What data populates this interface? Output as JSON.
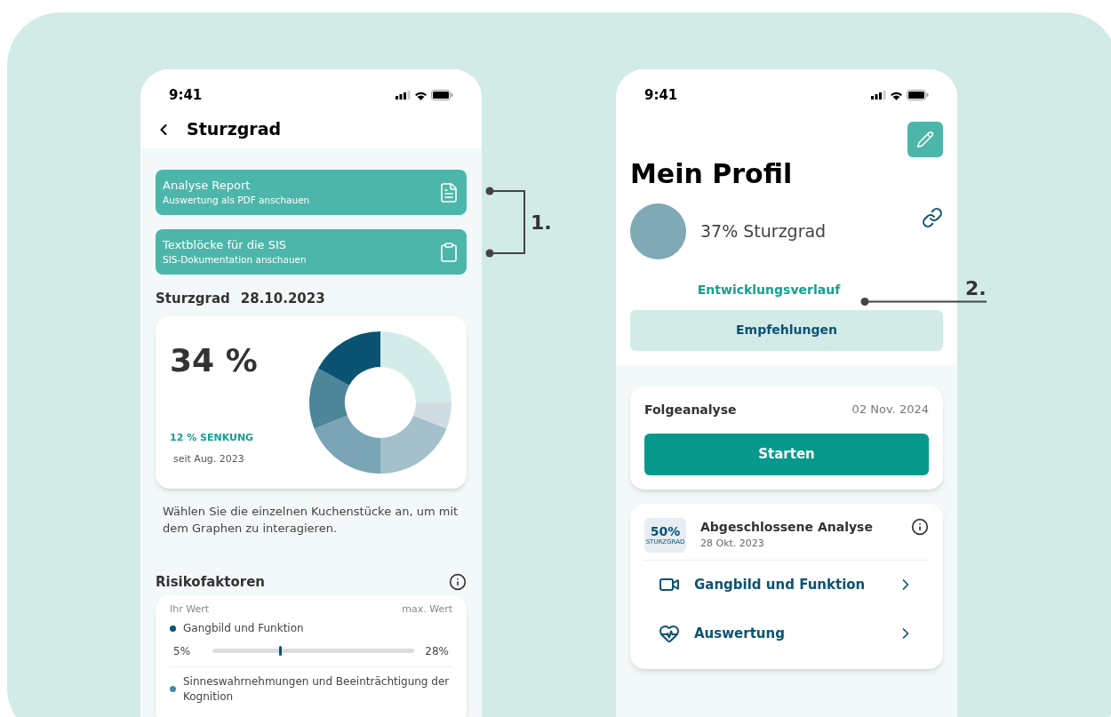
{
  "left_screen": {
    "status_time": "9:41",
    "title": "Sturzgrad",
    "actions": [
      {
        "title": "Analyse Report",
        "subtitle": "Auswertung als PDF anschauen",
        "kind": "document"
      },
      {
        "title": "Textblöcke für die SIS",
        "subtitle": "SIS-Dokumentation anschauen",
        "kind": "clipboard"
      }
    ],
    "section_title": "Sturzgrad",
    "section_date": "28.10.2023",
    "score": "34 %",
    "change": "12 % SENKUNG",
    "since": "seit Aug. 2023",
    "hint": "Wählen Sie die einzelnen Kuchenstücke an, um mit dem Graphen zu interagieren.",
    "risk_title": "Risikofaktoren",
    "risk_col_left": "Ihr Wert",
    "risk_col_right": "max. Wert",
    "risk_factors": [
      {
        "name": "Gangbild und Funktion",
        "color": "#0b5373",
        "value": "5%",
        "max": "28%",
        "level": 0.33
      },
      {
        "name": "Sinneswahrnehmungen und Beeinträchtigung der Kognition",
        "color": "#4b8aa0"
      }
    ]
  },
  "right_screen": {
    "status_time": "9:41",
    "title": "Mein Profil",
    "profile_score": "37% Sturzgrad",
    "history_link": "Entwicklungsverlauf",
    "recommendations_button": "Empfehlungen",
    "next_analysis": {
      "title": "Folgeanalyse",
      "date": "02 Nov. 2024",
      "button": "Starten"
    },
    "completed": {
      "badge_value": "50%",
      "badge_label": "STURZGRAD",
      "title": "Abgeschlossene Analyse",
      "date": "28 Okt. 2023",
      "items": [
        {
          "label": "Gangbild und Funktion",
          "kind": "video"
        },
        {
          "label": "Auswertung",
          "kind": "heart"
        }
      ]
    }
  },
  "annotations": [
    "1.",
    "2."
  ]
}
